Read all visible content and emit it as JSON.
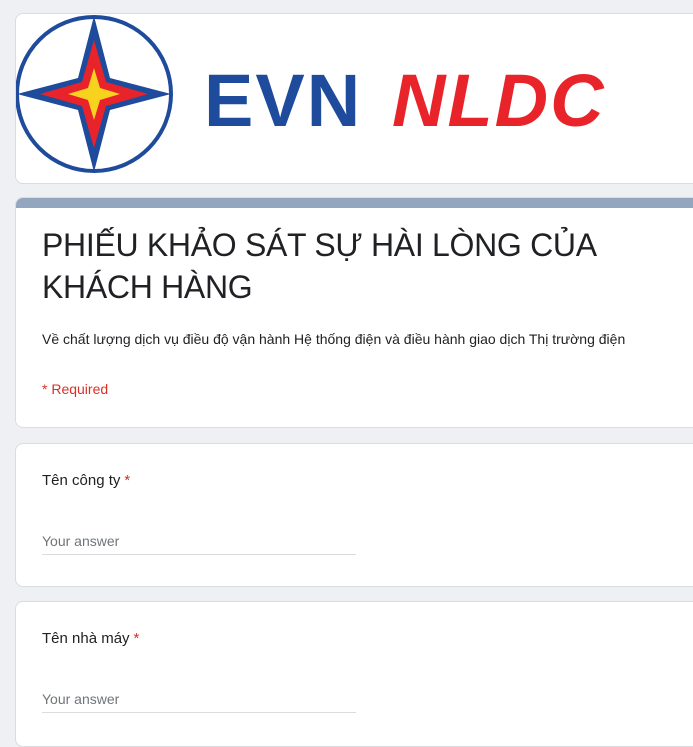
{
  "banner": {
    "brand_primary": "EVN",
    "brand_secondary": "NLDC",
    "primary_color": "#1f4b9d",
    "secondary_color": "#e8232a",
    "logo": "evn-star-logo-icon"
  },
  "form": {
    "accent_color": "#94a6bf",
    "title": "PHIẾU KHẢO SÁT SỰ HÀI LÒNG CỦA KHÁCH HÀNG",
    "description": "Về chất lượng dịch vụ điều độ vận hành Hệ thống điện và điều hành giao dịch Thị trường điện",
    "required_note": "* Required"
  },
  "questions": [
    {
      "label": "Tên công ty",
      "required_mark": "*",
      "placeholder": "Your answer",
      "value": ""
    },
    {
      "label": "Tên nhà máy",
      "required_mark": "*",
      "placeholder": "Your answer",
      "value": ""
    }
  ]
}
